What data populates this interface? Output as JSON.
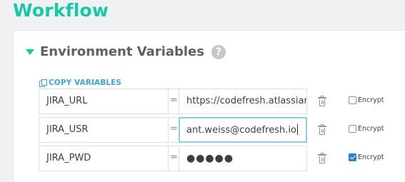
{
  "page": {
    "title": "Workflow"
  },
  "env_section": {
    "title": "Environment Variables",
    "help": "?",
    "copy_label": "COPY VARIABLES"
  },
  "variables": [
    {
      "key": "JIRA_URL",
      "eq": "=",
      "value": "https://codefresh.atlassian",
      "encrypt_label": "Encrypt",
      "encrypted": false
    },
    {
      "key": "JIRA_USR",
      "eq": "=",
      "value": "ant.weiss@codefresh.io",
      "encrypt_label": "Encrypt",
      "encrypted": false,
      "focused": true
    },
    {
      "key": "JIRA_PWD",
      "eq": "=",
      "value": "●●●●●",
      "encrypt_label": "Encrypt",
      "encrypted": true
    }
  ],
  "icons": {
    "collapse": "caret-down-icon",
    "help": "question-circle-icon",
    "copy": "copy-icon",
    "delete": "trash-icon"
  },
  "colors": {
    "accent": "#15c9a7",
    "link": "#3aa6dd",
    "focus": "#8bd0de",
    "checkbox_checked": "#2c7fd8"
  }
}
